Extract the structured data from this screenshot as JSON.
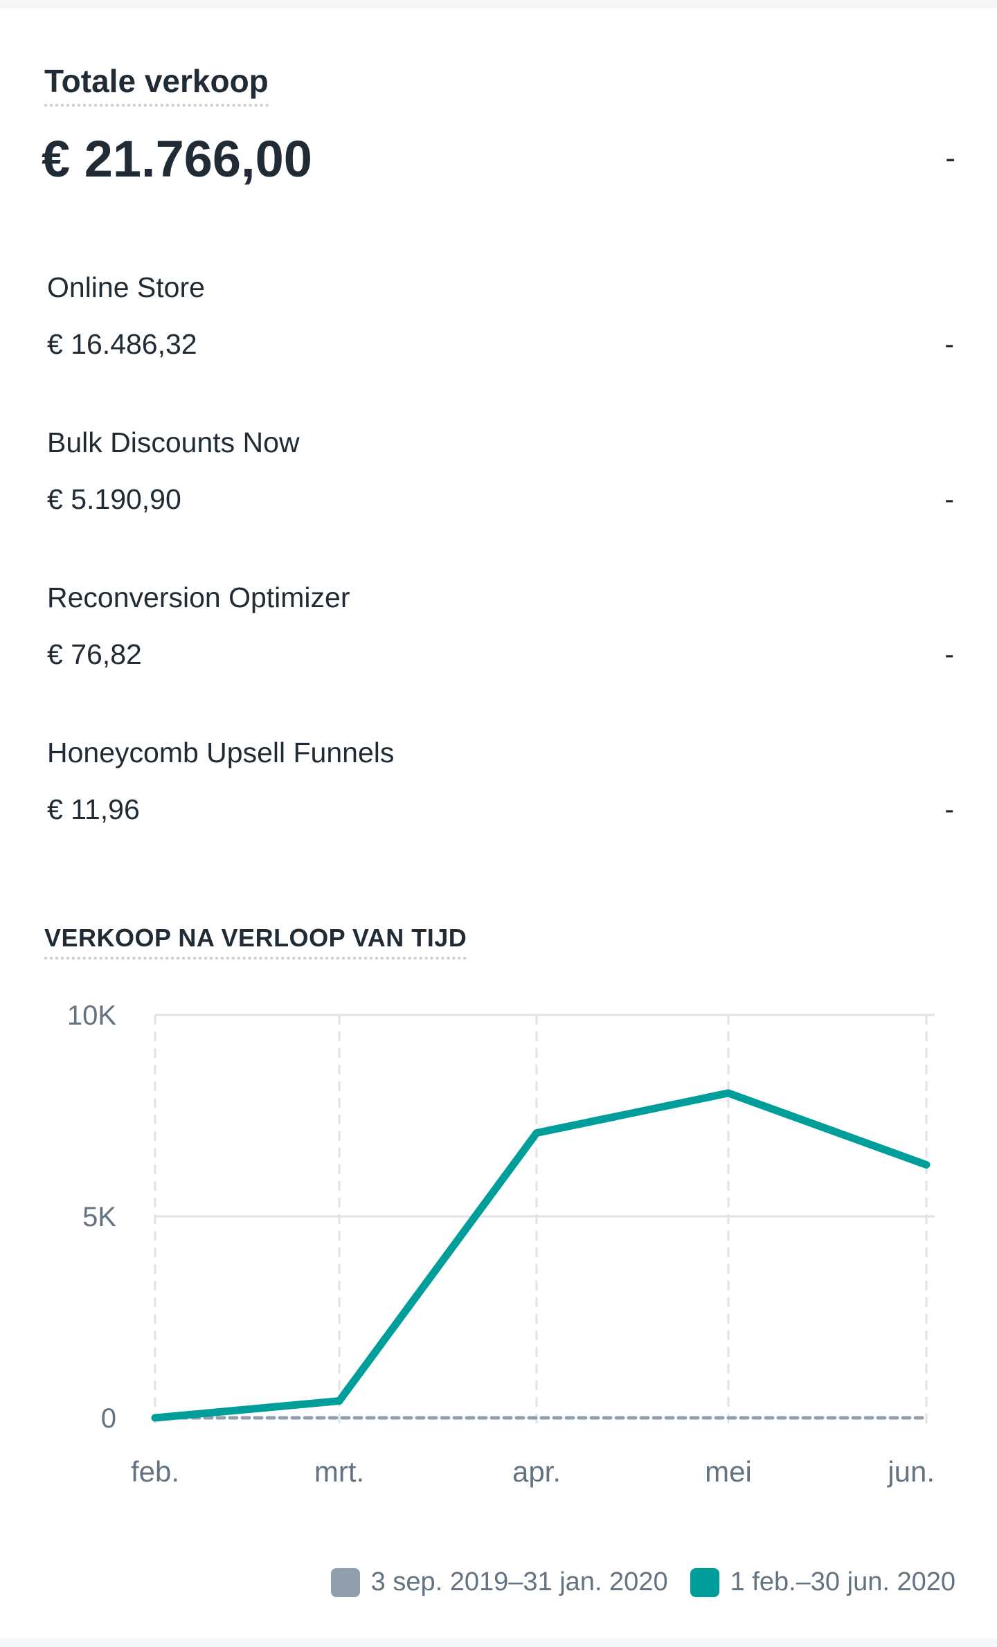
{
  "summary": {
    "title": "Totale verkoop",
    "value": "€ 21.766,00",
    "change": "-"
  },
  "channels": [
    {
      "name": "Online Store",
      "value": "€ 16.486,32",
      "change": "-"
    },
    {
      "name": "Bulk Discounts Now",
      "value": "€ 5.190,90",
      "change": "-"
    },
    {
      "name": "Reconversion Optimizer",
      "value": "€ 76,82",
      "change": "-"
    },
    {
      "name": "Honeycomb Upsell Funnels",
      "value": "€ 11,96",
      "change": "-"
    }
  ],
  "chart_title": "VERKOOP NA VERLOOP VAN TIJD",
  "chart_data": {
    "type": "line",
    "title": "VERKOOP NA VERLOOP VAN TIJD",
    "categories": [
      "feb.",
      "mrt.",
      "apr.",
      "mei",
      "jun."
    ],
    "ylim": [
      0,
      10000
    ],
    "yticks": [
      0,
      5000,
      10000
    ],
    "ytick_labels": [
      "0",
      "5K",
      "10K"
    ],
    "grid": true,
    "legend_position": "bottom-right",
    "series": [
      {
        "name": "3 sep. 2019–31 jan. 2020",
        "color": "#919eab",
        "style": "dashed",
        "values": [
          0,
          0,
          0,
          0,
          0
        ]
      },
      {
        "name": "1 feb.–30 jun. 2020",
        "color": "#009e9a",
        "style": "solid",
        "values": [
          0,
          420,
          7070,
          8060,
          6280
        ]
      }
    ]
  }
}
